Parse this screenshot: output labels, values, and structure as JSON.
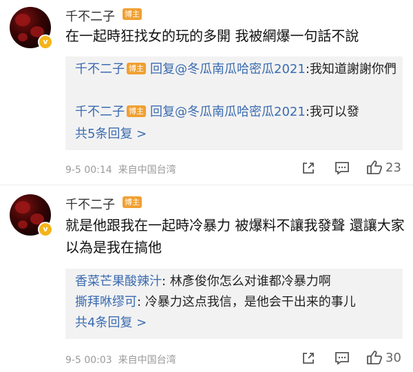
{
  "comments": [
    {
      "username": "千不二子",
      "tag": "博主",
      "text": "在一起時狂找女的玩的多開 我被網爆一句話不說",
      "replies": [
        {
          "name": "千不二子",
          "tag": "博主",
          "verb": "回复",
          "mention": "@冬瓜南瓜哈密瓜2021",
          "text": ":我知道謝謝你們"
        },
        {
          "name": "千不二子",
          "tag": "博主",
          "verb": "回复",
          "mention": "@冬瓜南瓜哈密瓜2021",
          "text": ":我可以發"
        }
      ],
      "more": "共5条回复 >",
      "time": "9-5 00:14",
      "source": "来自中国台湾",
      "likes": "23"
    },
    {
      "username": "千不二子",
      "tag": "博主",
      "text": "就是他跟我在一起時冷暴力 被爆料不讓我發聲 還讓大家以為是我在搞他",
      "replies": [
        {
          "name": "香菜芒果酸辣汁",
          "text": ": 林彥俊你怎么对谁都冷暴力啊"
        },
        {
          "name": "撕拜咻缪可",
          "text": ": 冷暴力这点我信，是他会干出来的事儿"
        }
      ],
      "more": "共4条回复 >",
      "time": "9-5 00:03",
      "source": "来自中国台湾",
      "likes": "30"
    }
  ],
  "icons": {
    "verified": "verified-v-icon",
    "share": "share-icon",
    "comment": "comment-icon",
    "like": "thumbs-up-icon"
  },
  "colors": {
    "link_blue": "#3a6bb0",
    "tag_orange": "#f0a032",
    "reply_bg": "#f2f2f2",
    "verified_gold": "#f5b41b"
  }
}
